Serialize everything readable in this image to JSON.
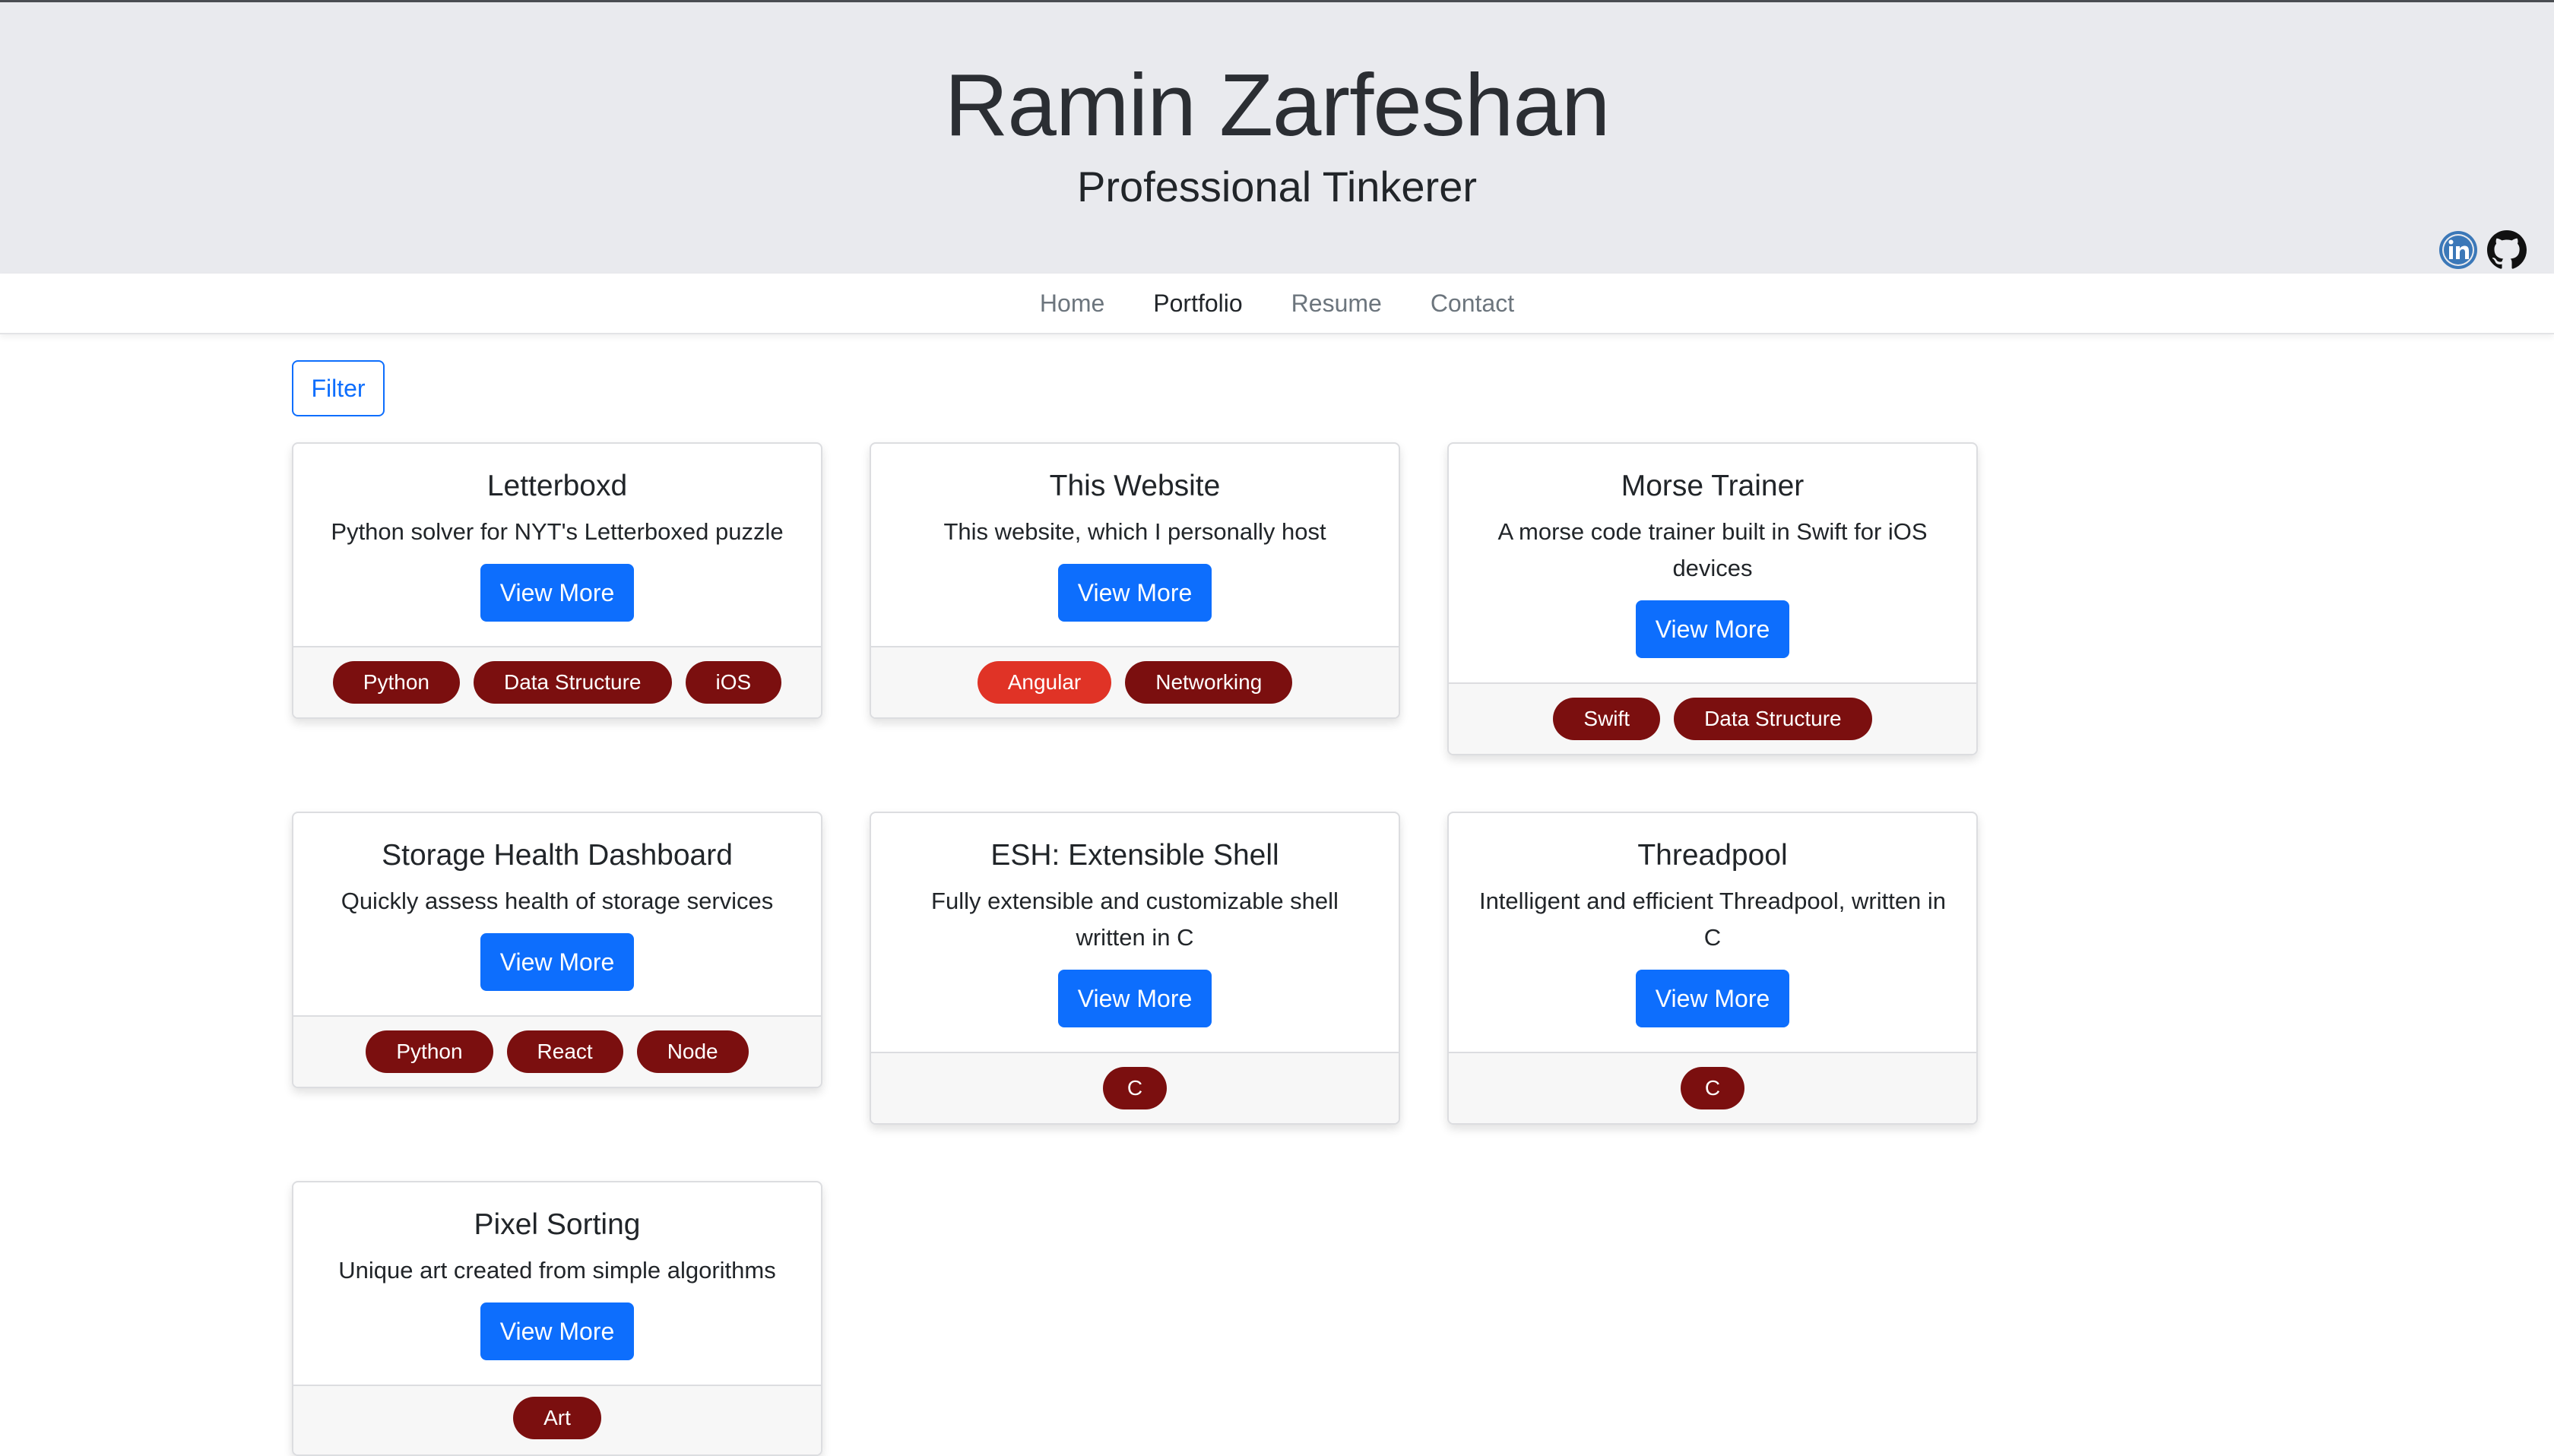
{
  "header": {
    "name": "Ramin Zarfeshan",
    "tagline": "Professional Tinkerer"
  },
  "social": {
    "linkedin_icon": "linkedin-icon",
    "github_icon": "github-icon"
  },
  "nav": {
    "items": [
      {
        "label": "Home",
        "active": false
      },
      {
        "label": "Portfolio",
        "active": true
      },
      {
        "label": "Resume",
        "active": false
      },
      {
        "label": "Contact",
        "active": false
      }
    ]
  },
  "filter": {
    "label": "Filter"
  },
  "view_more_label": "View More",
  "colors": {
    "header_bg": "#e9eaee",
    "primary": "#0d6efd",
    "tag_dark_red": "#7b0f0f",
    "tag_bright_red": "#e03326"
  },
  "cards": [
    {
      "title": "Letterboxd",
      "text": "Python solver for NYT's Letterboxed puzzle",
      "button": "View More",
      "tags": [
        {
          "label": "Python",
          "color": "#7b0f0f"
        },
        {
          "label": "Data Structure",
          "color": "#7b0f0f"
        },
        {
          "label": "iOS",
          "color": "#7b0f0f"
        }
      ]
    },
    {
      "title": "This Website",
      "text": "This website, which I personally host",
      "button": "View More",
      "tags": [
        {
          "label": "Angular",
          "color": "#e03326"
        },
        {
          "label": "Networking",
          "color": "#7b0f0f"
        }
      ]
    },
    {
      "title": "Morse Trainer",
      "text": "A morse code trainer built in Swift for iOS devices",
      "button": "View More",
      "tags": [
        {
          "label": "Swift",
          "color": "#7b0f0f"
        },
        {
          "label": "Data Structure",
          "color": "#7b0f0f"
        }
      ]
    },
    {
      "title": "Storage Health Dashboard",
      "text": "Quickly assess health of storage services",
      "button": "View More",
      "tags": [
        {
          "label": "Python",
          "color": "#7b0f0f"
        },
        {
          "label": "React",
          "color": "#7b0f0f"
        },
        {
          "label": "Node",
          "color": "#7b0f0f"
        }
      ]
    },
    {
      "title": "ESH: Extensible Shell",
      "text": "Fully extensible and customizable shell written in C",
      "button": "View More",
      "tags": [
        {
          "label": "C",
          "color": "#7b0f0f"
        }
      ]
    },
    {
      "title": "Threadpool",
      "text": "Intelligent and efficient Threadpool, written in C",
      "button": "View More",
      "tags": [
        {
          "label": "C",
          "color": "#7b0f0f"
        }
      ]
    },
    {
      "title": "Pixel Sorting",
      "text": "Unique art created from simple algorithms",
      "button": "View More",
      "tags": [
        {
          "label": "Art",
          "color": "#7b0f0f"
        }
      ]
    }
  ]
}
